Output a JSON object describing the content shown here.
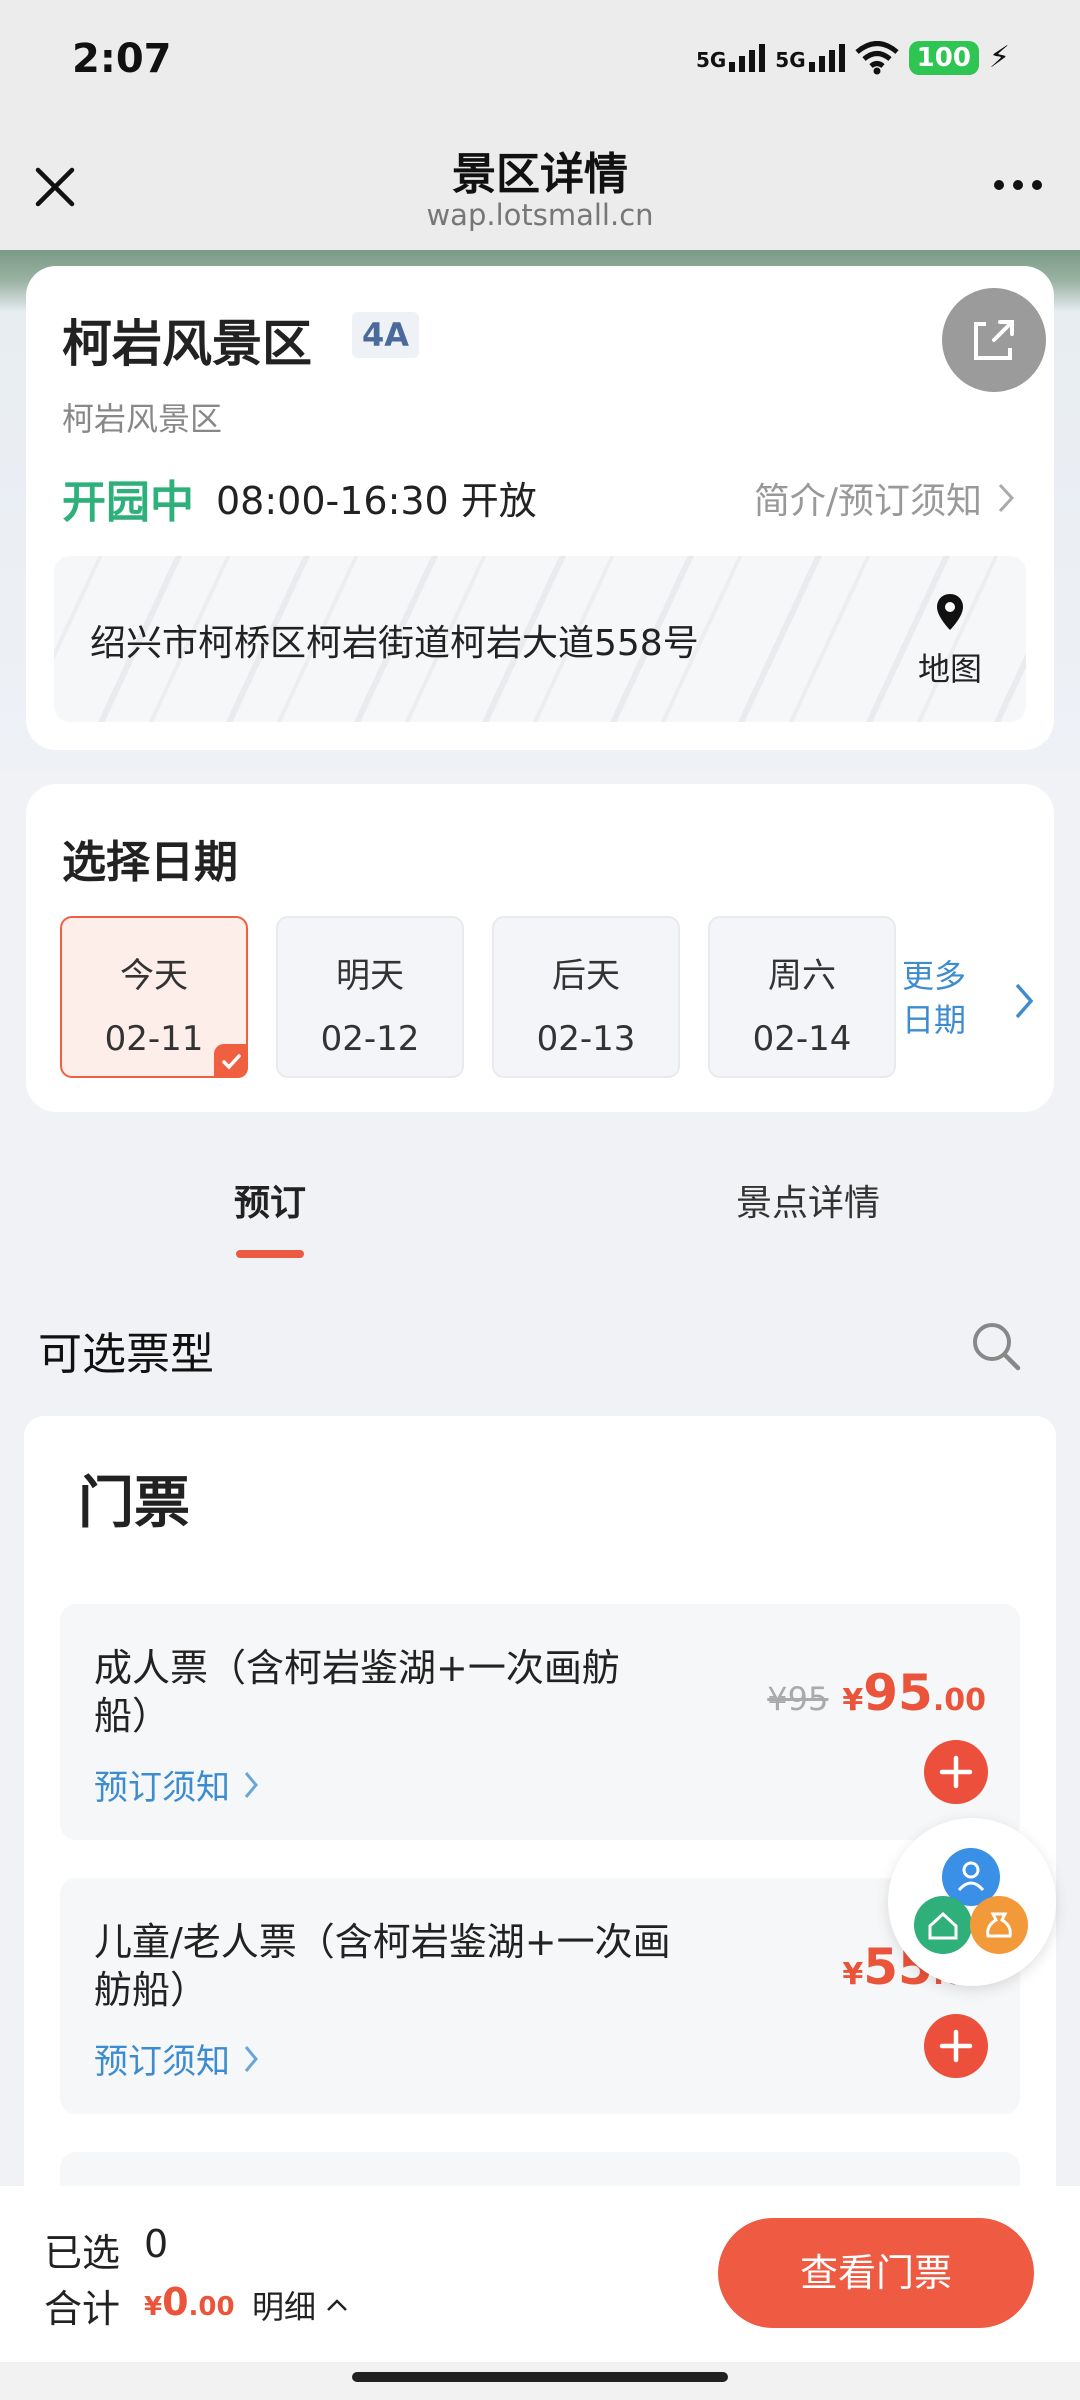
{
  "status_bar": {
    "time": "2:07",
    "network1": "5G",
    "network2": "5G",
    "battery": "100"
  },
  "navbar": {
    "title": "景区详情",
    "url": "wap.lotsmall.cn"
  },
  "scenic": {
    "name": "柯岩风景区",
    "level": "4A",
    "subname": "柯岩风景区",
    "status": "开园中",
    "hours": "08:00-16:30 开放",
    "intro_link": "简介/预订须知",
    "address": "绍兴市柯桥区柯岩街道柯岩大道558号",
    "map_label": "地图"
  },
  "date_select": {
    "title": "选择日期",
    "dates": [
      {
        "label": "今天",
        "date": "02-11"
      },
      {
        "label": "明天",
        "date": "02-12"
      },
      {
        "label": "后天",
        "date": "02-13"
      },
      {
        "label": "周六",
        "date": "02-14"
      }
    ],
    "more_line1": "更多",
    "more_line2": "日期"
  },
  "tabs": {
    "book": "预订",
    "detail": "景点详情"
  },
  "ticket_section": {
    "title": "可选票型",
    "category": "门票"
  },
  "tickets": [
    {
      "name": "成人票（含柯岩鉴湖+一次画舫船）",
      "notice": "预订须知",
      "original_price": "¥95",
      "currency": "¥",
      "price_int": "95",
      "price_frac": ".00"
    },
    {
      "name": "儿童/老人票（含柯岩鉴湖+一次画舫船）",
      "notice": "预订须知",
      "currency": "¥",
      "price_int": "55",
      "price_frac": ".00"
    }
  ],
  "bottom_bar": {
    "selected_label": "已选",
    "selected_count": "0",
    "total_label": "合计",
    "currency": "¥",
    "total_int": "0",
    "total_frac": ".00",
    "detail_label": "明细",
    "view_button": "查看门票"
  },
  "colors": {
    "accent": "#ec5a44",
    "open_green": "#2eb07a",
    "link_blue": "#3d8ccf"
  }
}
